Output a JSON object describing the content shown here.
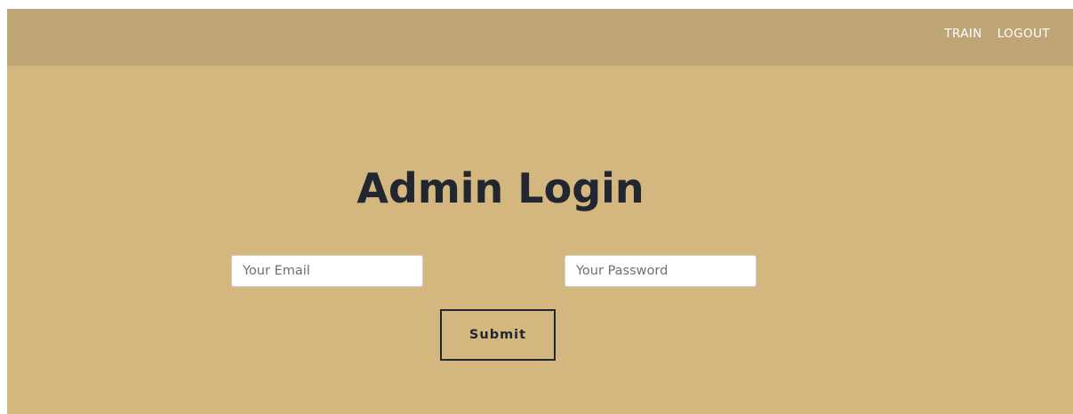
{
  "nav": {
    "items": [
      {
        "label": "TRAIN"
      },
      {
        "label": "LOGOUT"
      }
    ]
  },
  "main": {
    "title": "Admin Login",
    "email_placeholder": "Your Email",
    "password_placeholder": "Your Password",
    "submit_label": "Submit"
  },
  "colors": {
    "background": "#d3b77f",
    "navbar": "#bfa575",
    "text_dark": "#212631",
    "nav_text": "#ffffff"
  }
}
